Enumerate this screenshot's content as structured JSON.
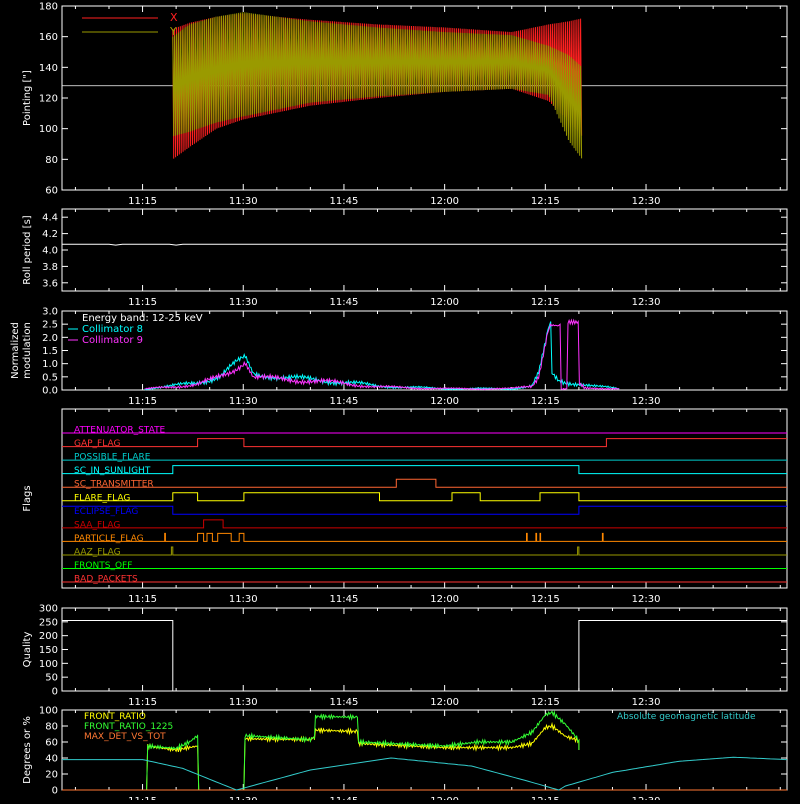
{
  "time_axis": {
    "ticks": [
      "11:15",
      "11:30",
      "11:45",
      "12:00",
      "12:15",
      "12:30"
    ],
    "tick_minutes": [
      675,
      690,
      705,
      720,
      735,
      750
    ],
    "range_minutes": [
      663,
      771
    ]
  },
  "chart_data": [
    {
      "id": "pointing",
      "type": "line",
      "ylabel": "Pointing [\"]",
      "ylim": [
        60,
        180
      ],
      "yticks": [
        "60",
        "80",
        "100",
        "120",
        "140",
        "160",
        "180"
      ],
      "ytick_values": [
        60,
        80,
        100,
        120,
        140,
        160,
        180
      ],
      "reference_y": 128,
      "legend_placement": "top-left",
      "series": [
        {
          "name": "X",
          "color": "#ff2020",
          "x": [
            679.5,
            682,
            686,
            690,
            700,
            710,
            720,
            730,
            735.5,
            738.5,
            740.5
          ],
          "min": [
            80,
            88,
            100,
            106,
            115,
            120,
            124,
            126,
            118,
            105,
            95
          ],
          "max": [
            165,
            169,
            173,
            175,
            171,
            168,
            166,
            163,
            168,
            170,
            172
          ]
        },
        {
          "name": "Y",
          "color": "#9a9a00",
          "x": [
            679.5,
            682,
            686,
            690,
            700,
            710,
            720,
            730,
            735.5,
            738.5,
            740.5
          ],
          "min": [
            95,
            98,
            104,
            108,
            117,
            121,
            124,
            126,
            122,
            92,
            80
          ],
          "max": [
            160,
            168,
            173,
            176,
            170,
            166,
            163,
            161,
            154,
            148,
            140
          ]
        }
      ]
    },
    {
      "id": "roll",
      "type": "line",
      "ylabel": "Roll period [s]",
      "ylim": [
        3.5,
        4.5
      ],
      "yticks": [
        "3.6",
        "3.8",
        "4.0",
        "4.2",
        "4.4"
      ],
      "ytick_values": [
        3.6,
        3.8,
        4.0,
        4.2,
        4.4
      ],
      "reference_y": 4.07,
      "series": [
        {
          "name": "",
          "color": "#ffffff",
          "x": [
            663,
            670,
            671,
            672,
            673,
            679,
            680,
            681,
            771
          ],
          "y": [
            4.07,
            4.07,
            4.06,
            4.07,
            4.07,
            4.07,
            4.06,
            4.07,
            4.07
          ]
        }
      ]
    },
    {
      "id": "modulation",
      "type": "line",
      "ylabel": "Normalized modulation",
      "ylim": [
        0,
        3
      ],
      "yticks": [
        "0.0",
        "0.5",
        "1.0",
        "1.5",
        "2.0",
        "2.5",
        "3.0"
      ],
      "ytick_values": [
        0,
        0.5,
        1,
        1.5,
        2,
        2.5,
        3
      ],
      "legend_placement": "top-left",
      "legend_title": "Energy band: 12-25 keV",
      "series": [
        {
          "name": "Collimator 8",
          "color": "#00ffff",
          "x": [
            675.3,
            677,
            683,
            685,
            686.5,
            690.3,
            691.5,
            693,
            700,
            705,
            710,
            720,
            730,
            733,
            734,
            735.4,
            735.8,
            736,
            737,
            738,
            739,
            740,
            741,
            742,
            743,
            744,
            745,
            746
          ],
          "y": [
            0.03,
            0.1,
            0.25,
            0.4,
            0.55,
            1.3,
            0.6,
            0.55,
            0.4,
            0.3,
            0.15,
            0.05,
            0.05,
            0.15,
            0.6,
            2.3,
            2.6,
            0.6,
            0.35,
            0.3,
            0.28,
            0.25,
            0.2,
            0.15,
            0.12,
            0.1,
            0.08,
            0.05
          ]
        },
        {
          "name": "Collimator 9",
          "color": "#ff33ff",
          "x": [
            675.3,
            677,
            683,
            685,
            686.5,
            690.3,
            691.5,
            693,
            700,
            705,
            710,
            720,
            730,
            733,
            734,
            735.4,
            735.8,
            736,
            737.2,
            737.2,
            738.2,
            738.2,
            739.9,
            739.9,
            740.6,
            740.6,
            742,
            746
          ],
          "y": [
            0.03,
            0.08,
            0.2,
            0.35,
            0.5,
            1.0,
            0.5,
            0.45,
            0.35,
            0.25,
            0.12,
            0.05,
            0.05,
            0.15,
            0.55,
            2.2,
            2.5,
            2.5,
            2.5,
            0.05,
            0.05,
            2.6,
            2.6,
            0.3,
            0.2,
            0.12,
            0.08,
            0.05
          ]
        }
      ]
    },
    {
      "id": "flags",
      "type": "line",
      "ylabel": "Flags",
      "series": [
        {
          "name": "ATTENUATOR_STATE",
          "color": "#ff00ff",
          "segments": [
            [
              663,
              0
            ],
            [
              735.3,
              1
            ],
            [
              739,
              0.3
            ],
            [
              739.5,
              1
            ],
            [
              771,
              1
            ]
          ]
        },
        {
          "name": "GAP_FLAG",
          "color": "#ff3333",
          "segments": [
            [
              663,
              0
            ],
            [
              675.6,
              0
            ],
            [
              675.6,
              1
            ],
            [
              784,
              1
            ],
            [
              784,
              0
            ]
          ],
          "steps": [
            [
              663,
              0
            ],
            [
              675.6,
              0
            ],
            [
              675.6,
              0
            ],
            [
              683.2,
              0
            ],
            [
              683.2,
              1
            ],
            [
              690.1,
              1
            ],
            [
              690.1,
              0
            ],
            [
              744.1,
              0
            ],
            [
              744.1,
              1
            ],
            [
              771,
              1
            ]
          ]
        },
        {
          "name": "POSSIBLE_FLARE",
          "color": "#00cccc",
          "steps": [
            [
              663,
              0
            ],
            [
              771,
              0
            ]
          ]
        },
        {
          "name": "SC_IN_SUNLIGHT",
          "color": "#00ffff",
          "steps": [
            [
              663,
              0
            ],
            [
              679.5,
              0
            ],
            [
              679.5,
              1
            ],
            [
              740,
              1
            ],
            [
              740,
              0
            ],
            [
              771,
              0
            ]
          ]
        },
        {
          "name": "SC_TRANSMITTER",
          "color": "#ff6633",
          "steps": [
            [
              663,
              0
            ],
            [
              712.8,
              0
            ],
            [
              712.8,
              1
            ],
            [
              718.7,
              1
            ],
            [
              718.7,
              0
            ],
            [
              771,
              0
            ]
          ]
        },
        {
          "name": "FLARE_FLAG",
          "color": "#ffff00",
          "steps": [
            [
              663,
              0
            ],
            [
              679.5,
              0
            ],
            [
              679.5,
              1
            ],
            [
              683.2,
              1
            ],
            [
              683.2,
              0
            ],
            [
              690.1,
              0
            ],
            [
              690.1,
              1
            ],
            [
              710.3,
              1
            ],
            [
              710.3,
              0
            ],
            [
              721.1,
              0
            ],
            [
              721.1,
              1
            ],
            [
              725.3,
              1
            ],
            [
              725.3,
              0
            ],
            [
              734.2,
              0
            ],
            [
              734.2,
              1
            ],
            [
              740,
              1
            ],
            [
              740,
              0
            ],
            [
              771,
              0
            ]
          ]
        },
        {
          "name": "ECLIPSE_FLAG",
          "color": "#0000ff",
          "steps": [
            [
              663,
              1
            ],
            [
              679.5,
              1
            ],
            [
              679.5,
              0
            ],
            [
              740,
              0
            ],
            [
              740,
              1
            ],
            [
              771,
              1
            ]
          ]
        },
        {
          "name": "SAA_FLAG",
          "color": "#cc0000",
          "steps": [
            [
              663,
              0
            ],
            [
              684.1,
              0
            ],
            [
              684.1,
              1
            ],
            [
              687,
              1
            ],
            [
              687,
              0
            ],
            [
              771,
              0
            ]
          ]
        },
        {
          "name": "PARTICLE_FLAG",
          "color": "#ff8800",
          "steps": [
            [
              663,
              0
            ],
            [
              678.3,
              0
            ],
            [
              678.3,
              1
            ],
            [
              678.4,
              1
            ],
            [
              678.4,
              0
            ],
            [
              683.2,
              0
            ],
            [
              683.2,
              1
            ],
            [
              684.1,
              1
            ],
            [
              684.1,
              0
            ],
            [
              684.6,
              0
            ],
            [
              684.6,
              1
            ],
            [
              685.4,
              1
            ],
            [
              685.4,
              0
            ],
            [
              686.2,
              0
            ],
            [
              686.2,
              1
            ],
            [
              688.2,
              1
            ],
            [
              688.2,
              0
            ],
            [
              689.4,
              0
            ],
            [
              689.4,
              1
            ],
            [
              690.1,
              1
            ],
            [
              690.1,
              0
            ],
            [
              732.2,
              0
            ],
            [
              732.2,
              1
            ],
            [
              732.3,
              1
            ],
            [
              732.3,
              0
            ],
            [
              733.6,
              0
            ],
            [
              733.6,
              1
            ],
            [
              733.7,
              1
            ],
            [
              733.7,
              0
            ],
            [
              734.2,
              0
            ],
            [
              734.2,
              1
            ],
            [
              734.3,
              1
            ],
            [
              734.3,
              0
            ],
            [
              743.5,
              0
            ],
            [
              743.5,
              1
            ],
            [
              743.6,
              1
            ],
            [
              743.6,
              0
            ],
            [
              771,
              0
            ]
          ]
        },
        {
          "name": "AAZ_FLAG",
          "color": "#999900",
          "steps": [
            [
              663,
              0
            ],
            [
              679.3,
              0
            ],
            [
              679.3,
              1
            ],
            [
              679.5,
              1
            ],
            [
              679.5,
              0
            ],
            [
              739.8,
              0
            ],
            [
              739.8,
              1
            ],
            [
              740,
              1
            ],
            [
              740,
              0
            ],
            [
              771,
              0
            ]
          ]
        },
        {
          "name": "FRONTS_OFF",
          "color": "#00ff00",
          "steps": [
            [
              663,
              0
            ],
            [
              771,
              0
            ]
          ]
        },
        {
          "name": "BAD_PACKETS",
          "color": "#ff3333",
          "steps": [
            [
              663,
              0
            ],
            [
              771,
              0
            ]
          ]
        }
      ]
    },
    {
      "id": "quality",
      "type": "line",
      "ylabel": "Quality",
      "ylim": [
        0,
        300
      ],
      "yticks": [
        "0",
        "50",
        "100",
        "150",
        "200",
        "250",
        "300"
      ],
      "ytick_values": [
        0,
        50,
        100,
        150,
        200,
        250,
        300
      ],
      "series": [
        {
          "name": "",
          "color": "#ffffff",
          "x": [
            663,
            679.5,
            679.5,
            740,
            740,
            771
          ],
          "y": [
            255,
            255,
            0,
            0,
            255,
            255
          ]
        }
      ]
    },
    {
      "id": "ratios",
      "type": "line",
      "ylabel": "Degrees or %",
      "ylim": [
        0,
        100
      ],
      "yticks": [
        "0",
        "20",
        "40",
        "60",
        "80",
        "100"
      ],
      "ytick_values": [
        0,
        20,
        40,
        60,
        80,
        100
      ],
      "legend_placement": "top-left",
      "series": [
        {
          "name": "FRONT_RATIO",
          "color": "#ffff00",
          "x": [
            675.6,
            675.6,
            680,
            683.2,
            683.2,
            690.1,
            690.1,
            700,
            700.6,
            700.6,
            707,
            707.2,
            707.2,
            720,
            730,
            733,
            735,
            736,
            738,
            740,
            740
          ],
          "y": [
            0,
            55,
            50,
            55,
            0,
            0,
            64,
            63,
            65,
            75,
            73,
            58,
            58,
            53,
            53,
            58,
            78,
            80,
            67,
            62,
            50
          ]
        },
        {
          "name": "FRONT_RATIO_1225",
          "color": "#33ff33",
          "x": [
            675.6,
            675.6,
            680,
            682,
            683.2,
            683.2,
            690.1,
            690.1,
            700,
            700.6,
            700.6,
            707,
            707.2,
            707.2,
            720,
            725,
            730,
            733,
            735,
            736,
            738,
            740,
            740
          ],
          "y": [
            0,
            55,
            52,
            60,
            68,
            0,
            0,
            68,
            63,
            66,
            92,
            91,
            60,
            60,
            55,
            60,
            60,
            72,
            94,
            97,
            82,
            62,
            50
          ]
        },
        {
          "name": "MAX_DET_VS_TOT",
          "color": "#ff7733",
          "x": [
            663,
            771
          ],
          "y": [
            0,
            0
          ]
        },
        {
          "name": "Absolute geomagnetic latitude",
          "color": "#33cccc",
          "x": [
            663,
            675,
            681,
            686,
            689,
            700,
            712,
            724,
            732,
            737,
            738,
            745,
            755,
            763,
            771
          ],
          "y": [
            38,
            38,
            27,
            10,
            0,
            25,
            40,
            30,
            12,
            0,
            5,
            22,
            36,
            41,
            38
          ]
        }
      ]
    }
  ]
}
